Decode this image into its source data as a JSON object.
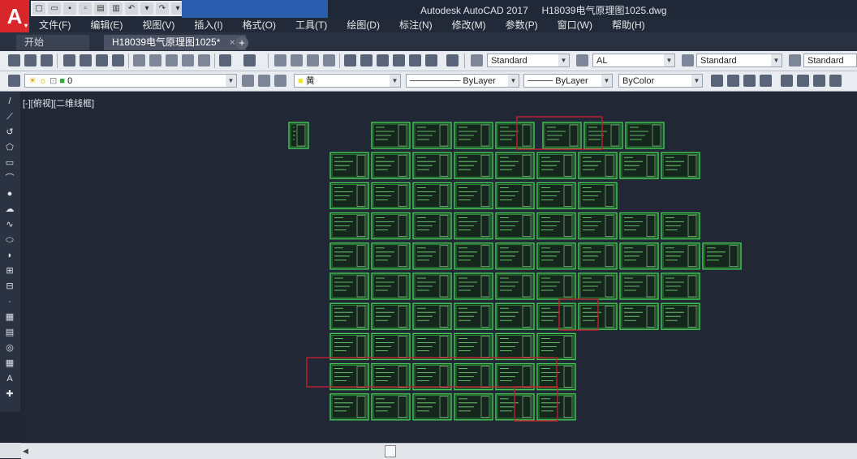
{
  "app": {
    "title": "Autodesk AutoCAD 2017",
    "document_name": "H18039电气原理图1025.dwg",
    "logo_letter": "A",
    "accent": "#d8262b"
  },
  "menu": [
    "文件(F)",
    "编辑(E)",
    "视图(V)",
    "插入(I)",
    "格式(O)",
    "工具(T)",
    "绘图(D)",
    "标注(N)",
    "修改(M)",
    "参数(P)",
    "窗口(W)",
    "帮助(H)"
  ],
  "tabs": [
    {
      "label": "开始",
      "active": false
    },
    {
      "label": "H18039电气原理图1025*",
      "active": true,
      "close": "×"
    }
  ],
  "tab_add": "+",
  "toolbar1": {
    "text_style": "Standard",
    "dim_style": "AL",
    "table_style": "Standard",
    "multileader_style": "Standard"
  },
  "toolbar2": {
    "layer": "0",
    "color": "黄",
    "linetype": "ByLayer",
    "lineweight": "ByLayer",
    "plotstyle": "ByColor"
  },
  "viewport_label": "[-][俯视][二维线框]",
  "left_tools": [
    "line-icon",
    "polyline-icon",
    "arc-icon",
    "polygon-icon",
    "rectangle-icon",
    "spline-icon",
    "circle-icon",
    "revcloud-icon",
    "spline-fit-icon",
    "ellipse-icon",
    "ellipse-arc-icon",
    "insert-block-icon",
    "make-block-icon",
    "point-icon",
    "hatch-icon",
    "gradient-icon",
    "region-icon",
    "table-icon",
    "mtext-icon",
    "add-selected-icon"
  ],
  "left_tool_glyphs": [
    "/",
    "⟋",
    "↺",
    "⬠",
    "▭",
    "⌒",
    "●",
    "☁",
    "∿",
    "⬭",
    "◗",
    "⊞",
    "⊟",
    "·",
    "▦",
    "▤",
    "◎",
    "▦",
    "A",
    "✚"
  ],
  "sheet_grid": {
    "rows": [
      {
        "cols": [
          1,
          3,
          4,
          5,
          6
        ],
        "red": []
      },
      {
        "cols": [
          2,
          3,
          4,
          5,
          6,
          7,
          8,
          9,
          10
        ],
        "red": []
      },
      {
        "cols": [
          2,
          3,
          4,
          5,
          6,
          7,
          8
        ],
        "red": []
      },
      {
        "cols": [
          2,
          3,
          4,
          5,
          6,
          7,
          8,
          9,
          10
        ],
        "red": []
      },
      {
        "cols": [
          2,
          3,
          4,
          5,
          6,
          7,
          8,
          9,
          10,
          11
        ],
        "red": []
      },
      {
        "cols": [
          2,
          3,
          4,
          5,
          6,
          7,
          8,
          9,
          10
        ],
        "red": []
      },
      {
        "cols": [
          2,
          3,
          4,
          5,
          6,
          7,
          8,
          9,
          10
        ],
        "red": []
      },
      {
        "cols": [
          2,
          3,
          4,
          5,
          6,
          7
        ],
        "red": []
      },
      {
        "cols": [
          2,
          3,
          4,
          5,
          6,
          7
        ],
        "red": []
      },
      {
        "cols": [
          2,
          3,
          4,
          5,
          6,
          7
        ],
        "red": []
      }
    ],
    "top_right_sheets": [
      7,
      8,
      9
    ]
  },
  "colors": {
    "canvas": "#212735",
    "sheet_border": "#49d85a",
    "selection_box": "#c12030"
  }
}
